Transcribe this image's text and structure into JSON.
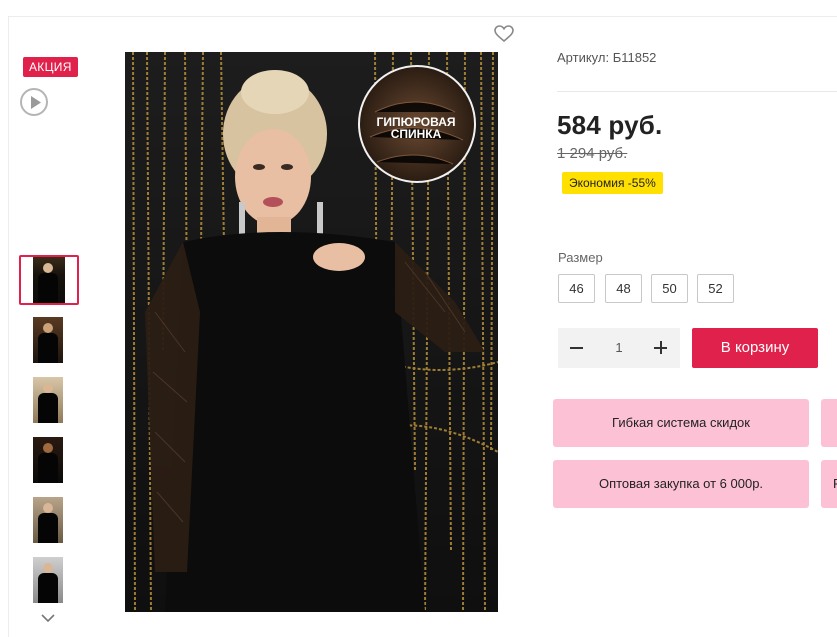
{
  "product": {
    "badge": "АКЦИЯ",
    "sku_text": "Артикул: Б11852",
    "price": "584 руб.",
    "old_price": "1 294 руб.",
    "savings": "Экономия -55%",
    "photo_caption": "ГИПЮРОВАЯ СПИНКА"
  },
  "sizes": {
    "label": "Размер",
    "options": [
      "46",
      "48",
      "50",
      "52"
    ]
  },
  "cart": {
    "quantity": "1",
    "add_label": "В корзину"
  },
  "info": {
    "discounts_label": "Гибкая система скидок",
    "wholesale_label": "Оптовая закупка от 6 000р.",
    "stub_label": "Р"
  },
  "colors": {
    "accent": "#e0214b",
    "savings_bg": "#ffe000",
    "info_bg": "#fdc1d5"
  },
  "icons": {
    "play": "play-icon",
    "favorite": "heart-icon",
    "scroll_down": "chevron-down-icon"
  }
}
